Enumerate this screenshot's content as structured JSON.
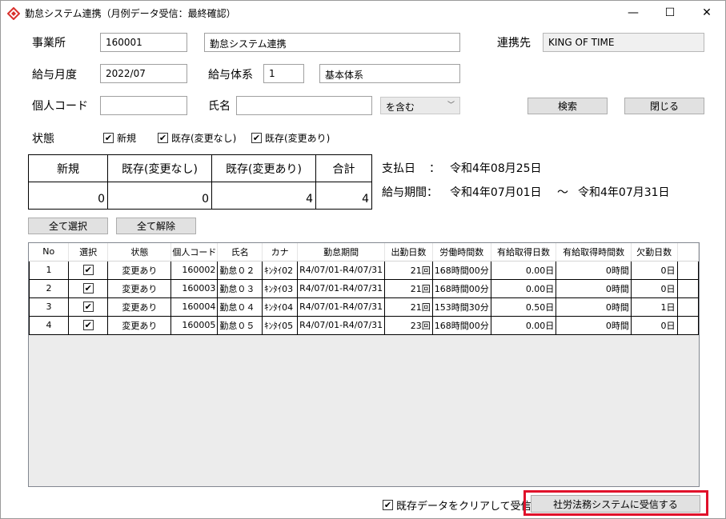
{
  "window": {
    "title": "勤怠システム連携（月例データ受信：最終確認）",
    "min_glyph": "—",
    "max_glyph": "☐",
    "close_glyph": "✕"
  },
  "form": {
    "office_label": "事業所",
    "office_code": "160001",
    "office_name": "勤怠システム連携",
    "partner_label": "連携先",
    "partner_value": "KING OF TIME",
    "pay_month_label": "給与月度",
    "pay_month_value": "2022/07",
    "pay_system_label": "給与体系",
    "pay_system_code": "1",
    "pay_system_name": "基本体系",
    "personal_code_label": "個人コード",
    "personal_code_value": "",
    "name_label": "氏名",
    "name_value": "",
    "match_option": "を含む",
    "search_button": "検索",
    "close_button": "閉じる"
  },
  "status": {
    "label": "状態",
    "options": [
      {
        "label": "新規",
        "checked": true
      },
      {
        "label": "既存(変更なし)",
        "checked": true
      },
      {
        "label": "既存(変更あり)",
        "checked": true
      }
    ]
  },
  "summary": {
    "headers": [
      "新規",
      "既存(変更なし)",
      "既存(変更あり)",
      "合計"
    ],
    "values": [
      "0",
      "0",
      "4",
      "4"
    ]
  },
  "payment": {
    "pay_date_label": "支払日",
    "colon": "：",
    "pay_date_value": "令和4年08月25日",
    "period_label": "給与期間：",
    "period_start": "令和4年07月01日",
    "period_sep": "～",
    "period_end": "令和4年07月31日"
  },
  "buttons": {
    "select_all": "全て選択",
    "deselect_all": "全て解除"
  },
  "grid": {
    "columns": [
      "No",
      "選択",
      "状態",
      "個人コード",
      "氏名",
      "カナ",
      "勤怠期間",
      "出勤日数",
      "労働時間数",
      "有給取得日数",
      "有給取得時間数",
      "欠勤日数"
    ],
    "rows": [
      {
        "no": "1",
        "checked": true,
        "status": "変更あり",
        "code": "160002",
        "name": "勤怠０２",
        "kana": "ｷﾝﾀｲ02",
        "period": "R4/07/01-R4/07/31",
        "work_days": "21回",
        "work_hours": "168時間00分",
        "paid_days": "0.00日",
        "paid_hours": "0時間",
        "absent_days": "0日"
      },
      {
        "no": "2",
        "checked": true,
        "status": "変更あり",
        "code": "160003",
        "name": "勤怠０３",
        "kana": "ｷﾝﾀｲ03",
        "period": "R4/07/01-R4/07/31",
        "work_days": "21回",
        "work_hours": "168時間00分",
        "paid_days": "0.00日",
        "paid_hours": "0時間",
        "absent_days": "0日"
      },
      {
        "no": "3",
        "checked": true,
        "status": "変更あり",
        "code": "160004",
        "name": "勤怠０４",
        "kana": "ｷﾝﾀｲ04",
        "period": "R4/07/01-R4/07/31",
        "work_days": "21回",
        "work_hours": "153時間30分",
        "paid_days": "0.50日",
        "paid_hours": "0時間",
        "absent_days": "1日"
      },
      {
        "no": "4",
        "checked": true,
        "status": "変更あり",
        "code": "160005",
        "name": "勤怠０５",
        "kana": "ｷﾝﾀｲ05",
        "period": "R4/07/01-R4/07/31",
        "work_days": "23回",
        "work_hours": "168時間00分",
        "paid_days": "0.00日",
        "paid_hours": "0時間",
        "absent_days": "0日"
      }
    ]
  },
  "footer": {
    "clear_existing_label": "既存データをクリアして受信する",
    "clear_existing_checked": true,
    "receive_button": "社労法務システムに受信する"
  },
  "check_glyph": "✔",
  "colors": {
    "highlight": "#e0102a",
    "icon_accent": "#d9302c"
  }
}
